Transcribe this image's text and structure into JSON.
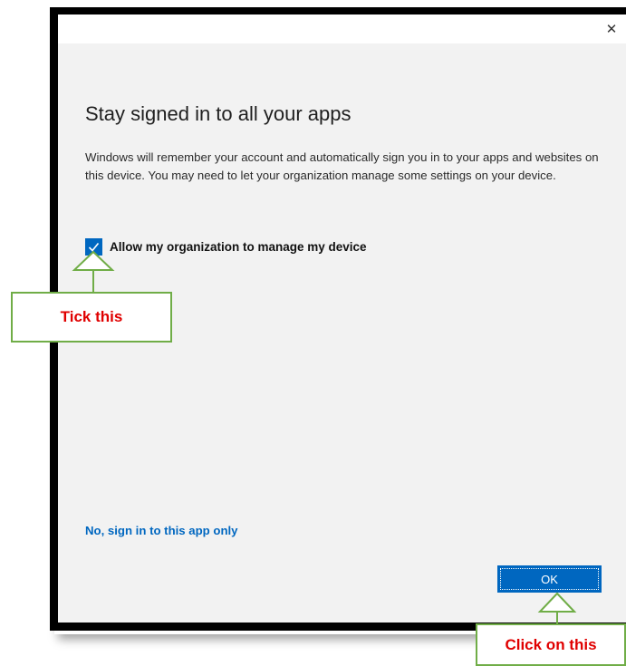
{
  "dialog": {
    "close_glyph": "✕",
    "heading": "Stay signed in to all your apps",
    "description": "Windows will remember your account and automatically sign you in to your apps and websites on this device. You may need to let your organization manage some settings on your device.",
    "checkbox": {
      "label": "Allow my organization to manage my device",
      "checked": true
    },
    "secondary_link": "No, sign in to this app only",
    "ok_label": "OK",
    "accent_color": "#0067c0"
  },
  "annotations": {
    "tick_label": "Tick this",
    "click_label": "Click on this",
    "border_color": "#70ad47",
    "text_color": "#e00000"
  }
}
